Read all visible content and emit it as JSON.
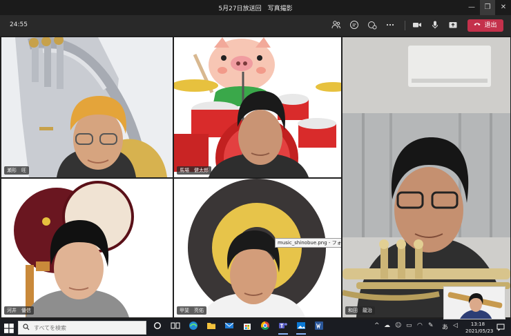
{
  "window": {
    "title": "5月27日放送回　写真撮影",
    "minimize": "—",
    "maximize": "❐",
    "close": "✕"
  },
  "toolbar": {
    "timer": "24:55",
    "icons": [
      "people-icon",
      "chat-icon",
      "reactions-icon",
      "more-icon",
      "camera-icon",
      "mic-icon",
      "share-icon"
    ],
    "leave_label": "退出"
  },
  "participants": [
    {
      "name": "瀬形　旺"
    },
    {
      "name": "馬場　健太郎"
    },
    {
      "name": "和田　龍治"
    },
    {
      "name": "河井　優信"
    },
    {
      "name": "甲斐　亮佑"
    }
  ],
  "tooltip": "music_shinobue.png - フォト",
  "taskbar": {
    "search_placeholder": "すべてを検索",
    "ime": "あ",
    "time": "13:18",
    "date": "2021/05/23"
  },
  "colors": {
    "leave": "#c4314b",
    "taskbar": "#1a1c22",
    "toolbar": "#292929"
  }
}
